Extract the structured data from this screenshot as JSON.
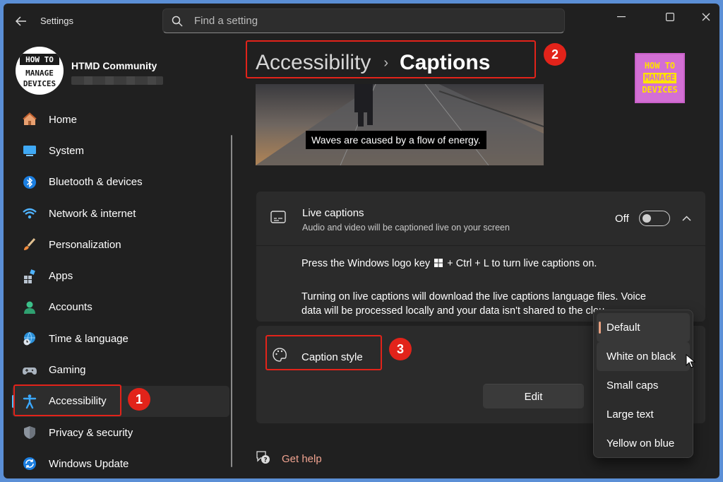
{
  "window": {
    "app_title": "Settings"
  },
  "search": {
    "placeholder": "Find a setting"
  },
  "user": {
    "name": "HTMD Community"
  },
  "avatar_logo": [
    "HOW TO",
    "MANAGE",
    "DEVICES"
  ],
  "sidebar": {
    "items": [
      {
        "label": "Home",
        "icon": "home-icon"
      },
      {
        "label": "System",
        "icon": "system-icon"
      },
      {
        "label": "Bluetooth & devices",
        "icon": "bluetooth-icon"
      },
      {
        "label": "Network & internet",
        "icon": "wifi-icon"
      },
      {
        "label": "Personalization",
        "icon": "brush-icon"
      },
      {
        "label": "Apps",
        "icon": "apps-icon"
      },
      {
        "label": "Accounts",
        "icon": "accounts-icon"
      },
      {
        "label": "Time & language",
        "icon": "globe-clock-icon"
      },
      {
        "label": "Gaming",
        "icon": "gamepad-icon"
      },
      {
        "label": "Accessibility",
        "icon": "accessibility-icon",
        "active": true
      },
      {
        "label": "Privacy & security",
        "icon": "shield-icon"
      },
      {
        "label": "Windows Update",
        "icon": "update-icon"
      }
    ]
  },
  "header": {
    "breadcrumb_parent": "Accessibility",
    "breadcrumb_separator": "›",
    "breadcrumb_current": "Captions"
  },
  "brand_logo": [
    "HOW TO",
    "MANAGE",
    "DEVICES"
  ],
  "preview": {
    "caption": "Waves are caused by a flow of energy."
  },
  "live_captions": {
    "title": "Live captions",
    "description": "Audio and video will be captioned live on your screen",
    "toggle_state": "Off",
    "info_line1": "Press the Windows logo key",
    "info_line1_after": "+ Ctrl + L to turn live captions on.",
    "info_line2": "Turning on live captions will download the live captions language files. Voice",
    "info_line3": "data will be processed locally and your data isn't shared to the cloud."
  },
  "caption_style": {
    "title": "Caption style",
    "edit_label": "Edit",
    "options": [
      "Default",
      "White on black",
      "Small caps",
      "Large text",
      "Yellow on blue"
    ],
    "selected": "Default",
    "hovered": "White on black"
  },
  "help": {
    "label": "Get help"
  },
  "annotations": [
    "1",
    "2",
    "3"
  ],
  "colors": {
    "accent": "#4cc2ff",
    "annotation": "#e2231a",
    "link": "#f0a390"
  }
}
